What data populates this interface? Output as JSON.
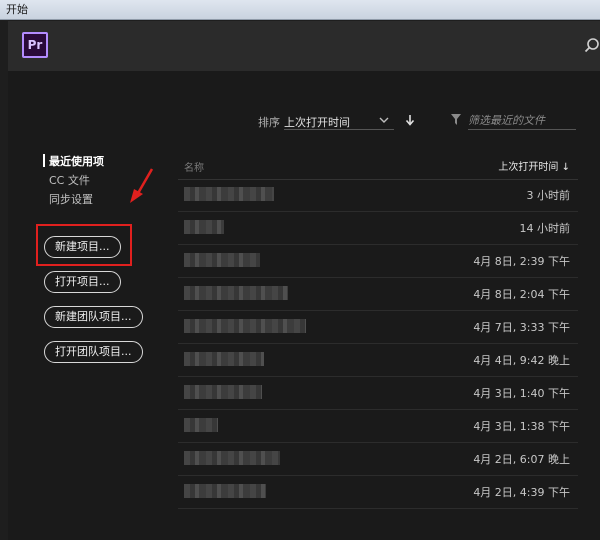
{
  "window": {
    "title": "开始"
  },
  "sort": {
    "label": "排序",
    "value": "上次打开时间"
  },
  "filter": {
    "placeholder": "筛选最近的文件"
  },
  "nav": {
    "items": [
      {
        "label": "最近使用项",
        "active": true
      },
      {
        "label": "CC 文件",
        "active": false
      },
      {
        "label": "同步设置",
        "active": false
      }
    ]
  },
  "buttons": {
    "new_project": "新建项目...",
    "open_project": "打开项目...",
    "new_team_project": "新建团队项目...",
    "open_team_project": "打开团队项目..."
  },
  "table": {
    "col_name": "名称",
    "col_date": "上次打开时间",
    "rows": [
      {
        "date": "3 小时前"
      },
      {
        "date": "14 小时前"
      },
      {
        "date": "4月 8日, 2:39 下午"
      },
      {
        "date": "4月 8日, 2:04 下午"
      },
      {
        "date": "4月 7日, 3:33 下午"
      },
      {
        "date": "4月 4日, 9:42 晚上"
      },
      {
        "date": "4月 3日, 1:40 下午"
      },
      {
        "date": "4月 3日, 1:38 下午"
      },
      {
        "date": "4月 2日, 6:07 晚上"
      },
      {
        "date": "4月 2日, 4:39 下午"
      }
    ]
  },
  "app": {
    "logo": "Pr"
  },
  "colors": {
    "annotation": "#e0201e",
    "accent": "#b48cff"
  }
}
